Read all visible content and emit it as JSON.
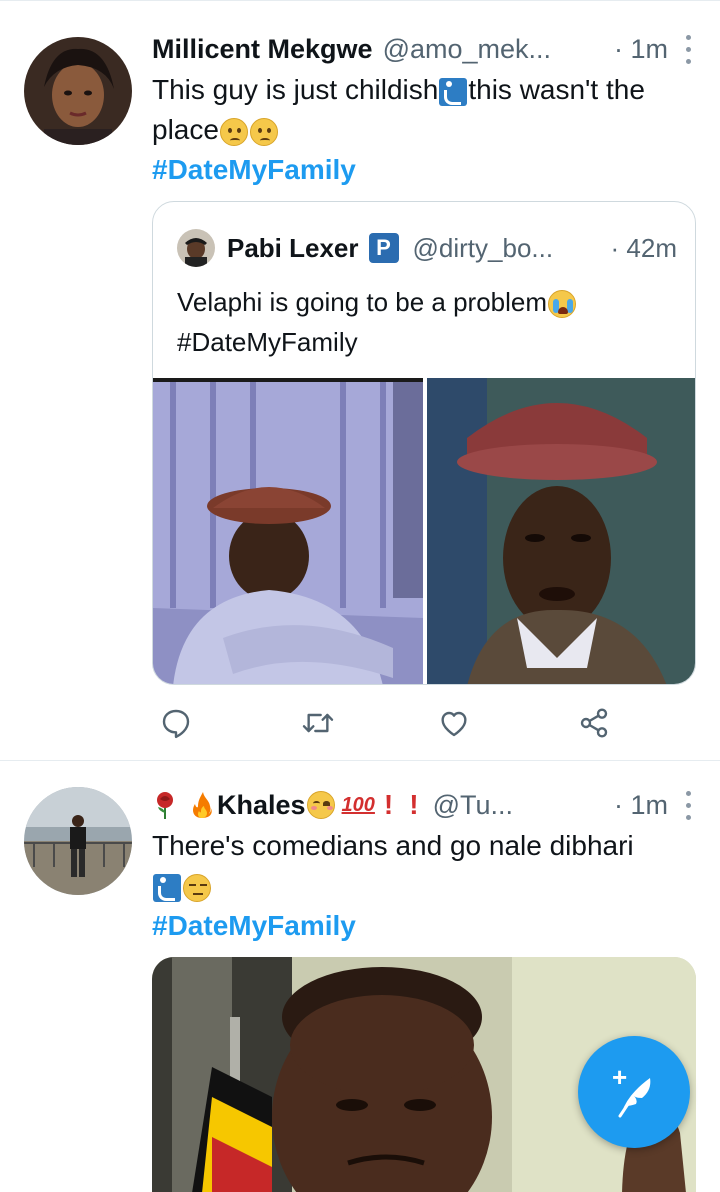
{
  "colors": {
    "accent": "#1d9bf0",
    "secondary_text": "#536471",
    "divider": "#e6ecf0"
  },
  "tweets": [
    {
      "author_name": "Millicent Mekgwe",
      "handle": "@amo_mek...",
      "time": "· 1m",
      "text_part1": "This guy is just childish",
      "text_part2": "this wasn't the",
      "text_part3": "place",
      "hashtag": "#DateMyFamily",
      "quoted": {
        "author_name": "Pabi Lexer",
        "badge": "P",
        "handle": "@dirty_bo...",
        "time": "· 42m",
        "text_part1": "Velaphi is going to be a problem",
        "hashtag": "#DateMyFamily"
      },
      "actions": {
        "reply_icon": "reply-icon",
        "retweet_icon": "retweet-icon",
        "like_icon": "heart-icon",
        "share_icon": "share-icon"
      }
    },
    {
      "author_name": "Khales",
      "hundred": "100",
      "bang1": "!",
      "bang2": "!",
      "handle": "@Tu...",
      "time": "· 1m",
      "text_part1": "There's comedians and go nale dibhari",
      "hashtag": "#DateMyFamily"
    }
  ],
  "fab": {
    "icon": "compose-feather-icon",
    "plus": "+"
  }
}
